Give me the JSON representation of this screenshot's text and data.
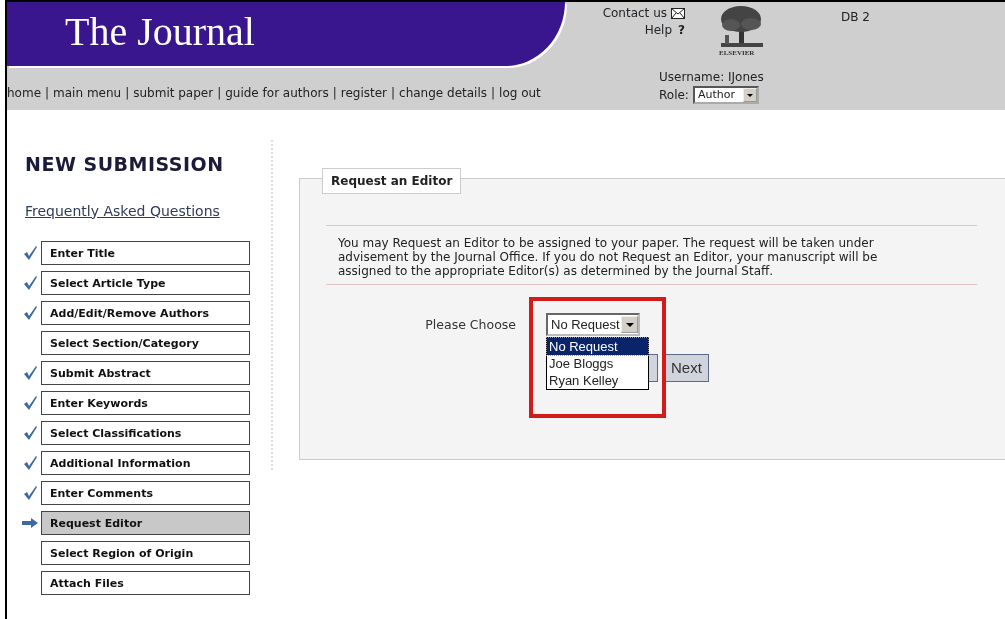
{
  "header": {
    "title": "The Journal",
    "contact": "Contact us",
    "help": "Help",
    "help_glyph": "?",
    "logo_text": "ELSEVIER",
    "db": "DB 2",
    "username": "Username: IJones",
    "role_label": "Role:",
    "role_value": "Author"
  },
  "nav": {
    "separator": "|",
    "links": [
      "home",
      "main menu",
      "submit paper",
      "guide for authors",
      "register",
      "change details",
      "log out"
    ]
  },
  "sidebar": {
    "title": "NEW SUBMISSION",
    "faq": "Frequently Asked Questions",
    "steps": [
      {
        "label": "Enter Title",
        "checked": true,
        "selected": false
      },
      {
        "label": "Select Article Type",
        "checked": true,
        "selected": false
      },
      {
        "label": "Add/Edit/Remove Authors",
        "checked": true,
        "selected": false
      },
      {
        "label": "Select Section/Category",
        "checked": false,
        "selected": false
      },
      {
        "label": "Submit Abstract",
        "checked": true,
        "selected": false
      },
      {
        "label": "Enter Keywords",
        "checked": true,
        "selected": false
      },
      {
        "label": "Select Classifications",
        "checked": true,
        "selected": false
      },
      {
        "label": "Additional Information",
        "checked": true,
        "selected": false
      },
      {
        "label": "Enter Comments",
        "checked": true,
        "selected": false
      },
      {
        "label": "Request Editor",
        "checked": false,
        "selected": true
      },
      {
        "label": "Select Region of Origin",
        "checked": false,
        "selected": false
      },
      {
        "label": "Attach Files",
        "checked": false,
        "selected": false
      }
    ]
  },
  "panel": {
    "legend": "Request an Editor",
    "text": "You may Request an Editor to be assigned to your paper. The request will be taken under advisement by the Journal Office. If you do not Request an Editor, your manuscript will be assigned to the appropriate Editor(s) as determined by the Journal Staff.",
    "choose_label": "Please Choose",
    "select_value": "No Request",
    "expanded": true,
    "options": [
      {
        "label": "No Request",
        "selected": true
      },
      {
        "label": "Joe Bloggs",
        "selected": false
      },
      {
        "label": "Ryan Kelley",
        "selected": false
      }
    ],
    "next": "Next",
    "highlight": true
  }
}
